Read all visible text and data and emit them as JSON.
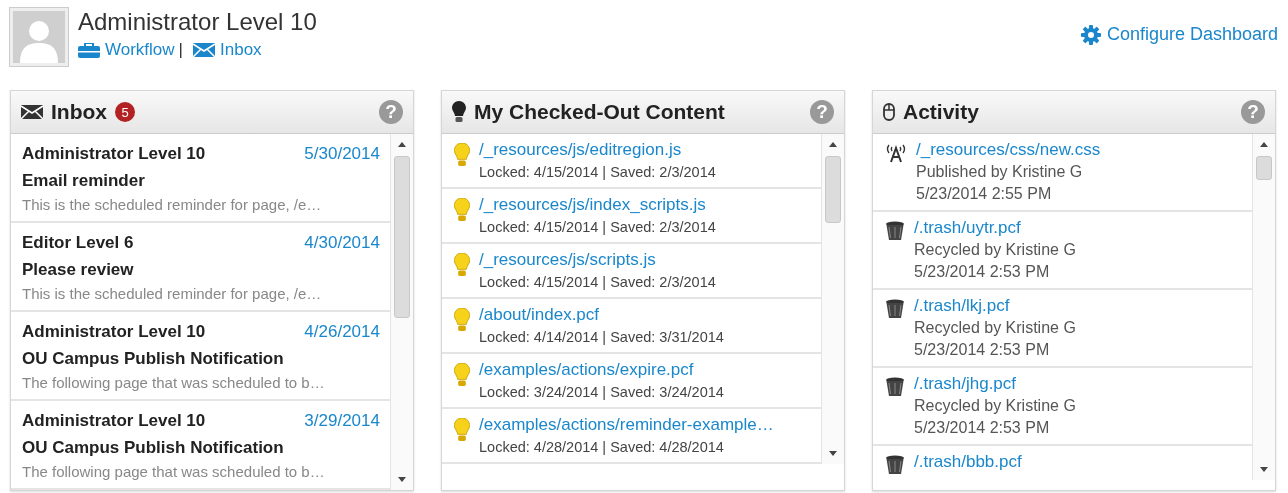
{
  "user": {
    "name": "Administrator Level 10",
    "links": [
      {
        "label": "Workflow",
        "kind": "workflow"
      },
      {
        "label": "Inbox",
        "kind": "inbox"
      }
    ],
    "separator": "|"
  },
  "configure": {
    "label": "Configure Dashboard"
  },
  "inbox": {
    "title": "Inbox",
    "badge": "5",
    "help": "?",
    "messages": [
      {
        "from": "Administrator Level 10",
        "date": "5/30/2014",
        "subject": "Email reminder",
        "preview": "This is the scheduled reminder for page, /e…"
      },
      {
        "from": "Editor Level 6",
        "date": "4/30/2014",
        "subject": "Please review",
        "preview": "This is the scheduled reminder for page, /e…"
      },
      {
        "from": "Administrator Level 10",
        "date": "4/26/2014",
        "subject": "OU Campus Publish Notification",
        "preview": "The following page that was scheduled to b…"
      },
      {
        "from": "Administrator Level 10",
        "date": "3/29/2014",
        "subject": "OU Campus Publish Notification",
        "preview": "The following page that was scheduled to b…"
      }
    ]
  },
  "checked_out": {
    "title": "My Checked-Out Content",
    "help": "?",
    "items": [
      {
        "path": "/_resources/js/editregion.js",
        "info": "Locked: 4/15/2014 | Saved: 2/3/2014"
      },
      {
        "path": "/_resources/js/index_scripts.js",
        "info": "Locked: 4/15/2014 | Saved: 2/3/2014"
      },
      {
        "path": "/_resources/js/scripts.js",
        "info": "Locked: 4/15/2014 | Saved: 2/3/2014"
      },
      {
        "path": "/about/index.pcf",
        "info": "Locked: 4/14/2014 | Saved: 3/31/2014"
      },
      {
        "path": "/examples/actions/expire.pcf",
        "info": "Locked: 3/24/2014 | Saved: 3/24/2014"
      },
      {
        "path": "/examples/actions/reminder-example…",
        "info": "Locked: 4/28/2014 | Saved: 4/28/2014"
      }
    ]
  },
  "activity": {
    "title": "Activity",
    "help": "?",
    "items": [
      {
        "kind": "published",
        "path": "/_resources/css/new.css",
        "action": "Published by Kristine G",
        "time": "5/23/2014 2:55 PM"
      },
      {
        "kind": "recycled",
        "path": "/.trash/uytr.pcf",
        "action": "Recycled by Kristine G",
        "time": "5/23/2014 2:53 PM"
      },
      {
        "kind": "recycled",
        "path": "/.trash/lkj.pcf",
        "action": "Recycled by Kristine G",
        "time": "5/23/2014 2:53 PM"
      },
      {
        "kind": "recycled",
        "path": "/.trash/jhg.pcf",
        "action": "Recycled by Kristine G",
        "time": "5/23/2014 2:53 PM"
      },
      {
        "kind": "recycled",
        "path": "/.trash/bbb.pcf"
      }
    ]
  }
}
